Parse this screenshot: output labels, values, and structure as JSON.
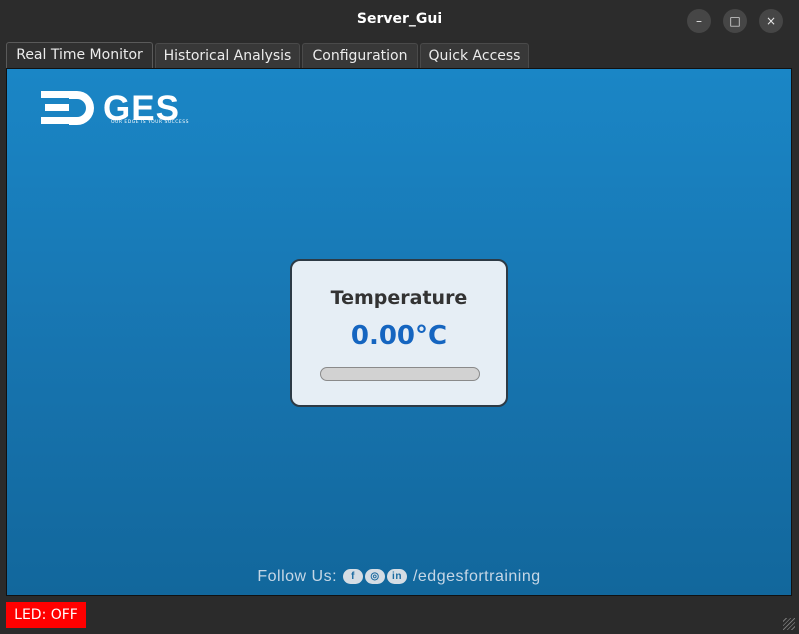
{
  "window": {
    "title": "Server_Gui"
  },
  "window_controls": {
    "minimize": "–",
    "maximize": "□",
    "close": "×"
  },
  "tabs": [
    {
      "label": "Real Time Monitor"
    },
    {
      "label": "Historical Analysis"
    },
    {
      "label": "Configuration"
    },
    {
      "label": "Quick Access"
    }
  ],
  "logo": {
    "text_g": "GES",
    "tagline": "OUR EDGE IS YOUR SUCCESS"
  },
  "temperature": {
    "label": "Temperature",
    "value": "0.00°C",
    "progress_percent": 0
  },
  "footer": {
    "follow_label": "Follow Us:",
    "icons": [
      "f",
      "◎",
      "in"
    ],
    "handle": "/edgesfortraining"
  },
  "status": {
    "led_text": "LED: OFF"
  },
  "colors": {
    "led_off": "#ff0000",
    "accent": "#1565c0"
  }
}
